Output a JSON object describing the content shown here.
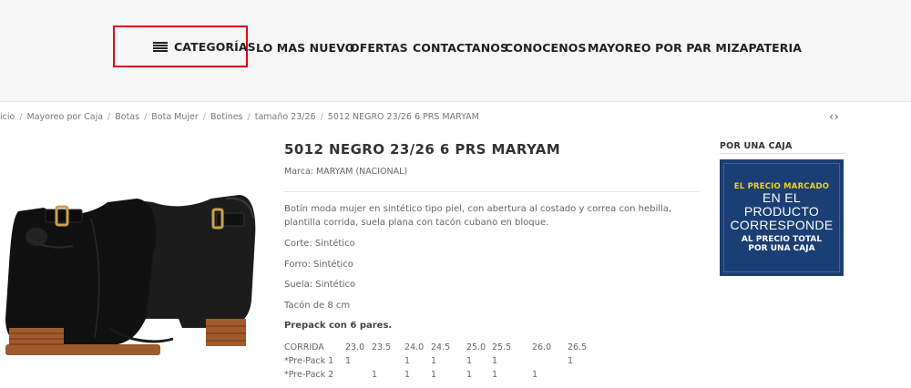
{
  "nav": {
    "categories_label": "CATEGORÍAS",
    "items": [
      "LO MAS NUEVO",
      "OFERTAS",
      "CONTACTANOS",
      "CONOCENOS",
      "MAYOREO POR PAR MIZAPATERIA"
    ],
    "highlight_color": "#e0001b"
  },
  "breadcrumb": [
    "icio",
    "Mayoreo por Caja",
    "Botas",
    "Bota Mujer",
    "Botines",
    "tamaño 23/26",
    "5012 NEGRO 23/26 6 PRS MARYAM"
  ],
  "pager": {
    "prev": "‹",
    "next": "›"
  },
  "product": {
    "title": "5012 NEGRO 23/26 6 PRS MARYAM",
    "brand": "Marca: MARYAM (NACIONAL)",
    "description": "Botín moda mujer en sintético tipo piel, con abertura al costado y correa con hebilla, plantilla corrida, suela plana con tacón cubano en bloque.",
    "specs": [
      "Corte: Sintético",
      "Forro: Sintético",
      "Suela: Sintético",
      "Tacón de 8 cm"
    ],
    "prepack_label": "Prepack con 6 pares.",
    "size_table": {
      "header": [
        "CORRIDA",
        "23.0",
        "23.5",
        "24.0",
        "24.5",
        "25.0",
        "25.5",
        "26.0",
        "26.5"
      ],
      "rows": [
        [
          "*Pre-Pack 1",
          "1",
          "",
          "1",
          "1",
          "1",
          "1",
          "",
          "1"
        ],
        [
          "*Pre-Pack 2",
          "",
          "1",
          "1",
          "1",
          "1",
          "1",
          "1",
          ""
        ]
      ]
    }
  },
  "sidebar": {
    "title": "POR UNA CAJA",
    "promo": {
      "line1": "EL PRECIO MARCADO",
      "line2": "EN EL PRODUCTO",
      "line3": "CORRESPONDE",
      "line4": "AL PRECIO TOTAL",
      "line5": "POR UNA CAJA",
      "bg_color": "#1b3f74",
      "accent_color": "#f2d21a"
    }
  }
}
